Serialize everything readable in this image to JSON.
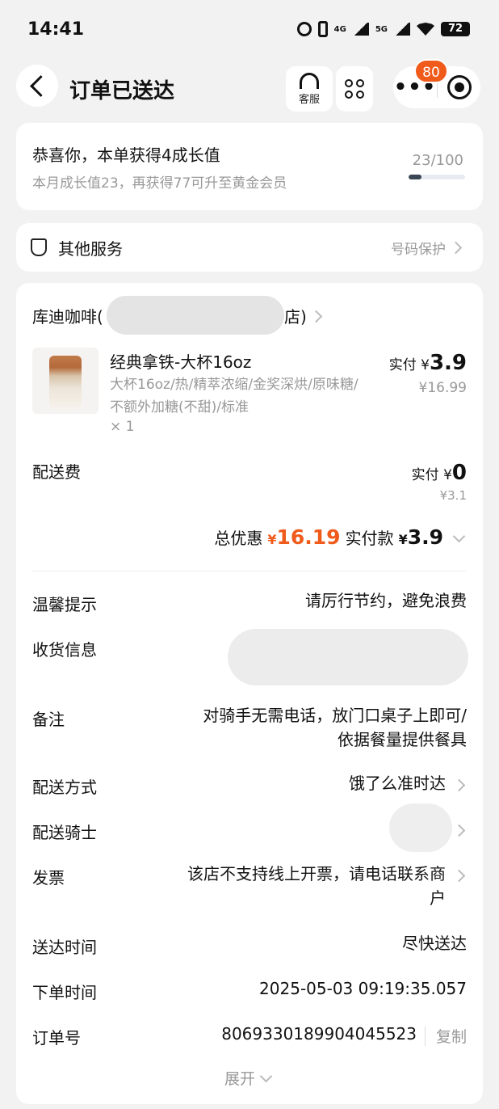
{
  "status_bar": {
    "time": "14:41",
    "network_1": "4G",
    "network_2": "5G",
    "battery": "72"
  },
  "nav": {
    "title": "订单已送达",
    "service_label": "客服",
    "notification_count": "80"
  },
  "growth": {
    "headline": "恭喜你，本单获得4成长值",
    "subtext": "本月成长值23，再获得77可升至黄金会员",
    "progress_text": "23/100",
    "progress_fraction": 0.23
  },
  "services": {
    "label": "其他服务",
    "right_label": "号码保护"
  },
  "shop": {
    "name_prefix": "库迪咖啡(",
    "name_suffix": "店)"
  },
  "product": {
    "name": "经典拿铁-大杯16oz",
    "spec": "大杯16oz/热/精萃浓缩/金奖深烘/原味糖/不额外加糖(不甜)/标准",
    "qty": "× 1",
    "paid_prefix": "实付 ¥",
    "paid_amount": "3.9",
    "original_price": "¥16.99"
  },
  "delivery_fee": {
    "label": "配送费",
    "paid_prefix": "实付 ¥",
    "paid_amount": "0",
    "original_price": "¥3.1"
  },
  "totals": {
    "discount_label": "总优惠",
    "currency": "¥",
    "discount_amount": "16.19",
    "paid_label": "实付款",
    "paid_amount": "3.9"
  },
  "details": {
    "tip_label": "温馨提示",
    "tip_value": "请厉行节约，避免浪费",
    "address_label": "收货信息",
    "note_label": "备注",
    "note_line1": "对骑手无需电话，放门口桌子上即可/",
    "note_line2": "依据餐量提供餐具",
    "method_label": "配送方式",
    "method_value": "饿了么准时达",
    "rider_label": "配送骑士",
    "invoice_label": "发票",
    "invoice_line1": "该店不支持线上开票，请电话联系商",
    "invoice_line2": "户",
    "arrive_label": "送达时间",
    "arrive_value": "尽快送达",
    "order_time_label": "下单时间",
    "order_time_value": "2025-05-03 09:19:35.057",
    "order_no_label": "订单号",
    "order_no_value": "8069330189904045523",
    "copy_label": "复制",
    "expand_label": "展开"
  }
}
